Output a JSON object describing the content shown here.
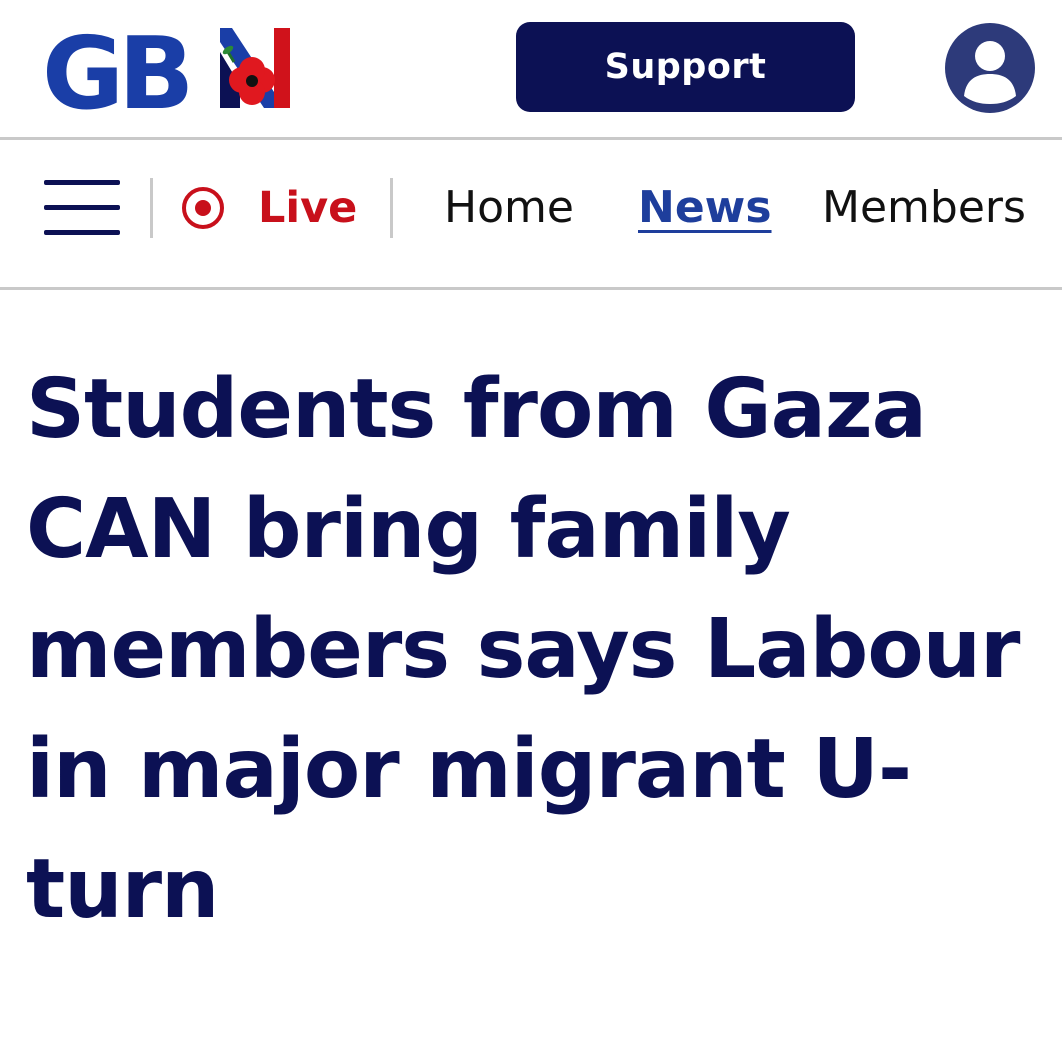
{
  "header": {
    "logo_text": "GB",
    "support_label": "Support",
    "account_icon": "user-avatar-icon",
    "colors": {
      "navy": "#0c1154",
      "logo_blue": "#1a3ea7",
      "logo_red": "#d0121b",
      "poppy_red": "#e0181f"
    }
  },
  "nav": {
    "menu_icon": "hamburger-menu-icon",
    "live_icon": "live-dot-icon",
    "live_label": "Live",
    "live_color": "#c8101b",
    "links": [
      {
        "label": "Home",
        "active": false
      },
      {
        "label": "News",
        "active": true
      },
      {
        "label": "Members",
        "active": false
      }
    ],
    "active_color": "#1e3e9c"
  },
  "article": {
    "headline": "Students from Gaza CAN bring family members says Labour in major migrant U-turn"
  }
}
